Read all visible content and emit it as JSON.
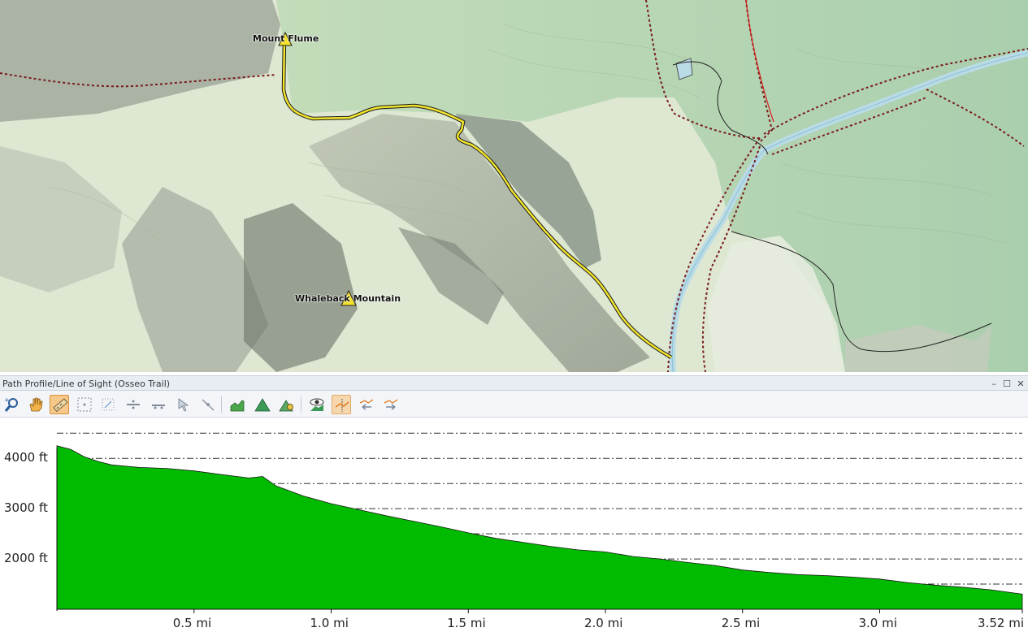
{
  "map": {
    "peaks": [
      {
        "name": "Mount Flume"
      },
      {
        "name": "Whaleback Mountain"
      }
    ],
    "colors": {
      "route": "#f2e52b",
      "trail": "#7a1b1b",
      "water": "#b9dbe6",
      "terrain_low": "#e8efdc",
      "terrain_shade": "#8a9086",
      "forest": "#b8d5b0"
    }
  },
  "panel": {
    "title": "Path Profile/Line of Sight (Osseo Trail)",
    "window_buttons": {
      "minimize": "–",
      "restore": "☐",
      "close": "✕"
    }
  },
  "toolbar": {
    "tools": [
      {
        "name": "zoom-icon"
      },
      {
        "name": "pan-hand-icon"
      },
      {
        "name": "ruler-measure-icon",
        "active": true
      },
      {
        "name": "grid-select-icon"
      },
      {
        "name": "grid-points-icon"
      },
      {
        "name": "horizontal-line-icon"
      },
      {
        "name": "line-segment-icon"
      },
      {
        "name": "pointer-icon"
      },
      {
        "name": "point-line-icon"
      },
      {
        "name": "profile-chart-icon"
      },
      {
        "name": "terrain-icon"
      },
      {
        "name": "terrain-settings-icon"
      },
      {
        "name": "line-of-sight-icon"
      },
      {
        "name": "show-profile-icon"
      },
      {
        "name": "profile-back-icon"
      },
      {
        "name": "profile-forward-icon"
      }
    ]
  },
  "chart_data": {
    "type": "area",
    "xlabel": "",
    "ylabel": "",
    "x_unit": "mi",
    "y_unit": "ft",
    "xlim": [
      0,
      3.52
    ],
    "ylim": [
      1000,
      4650
    ],
    "y_ticks": [
      {
        "value": 2000,
        "label": "2000 ft"
      },
      {
        "value": 3000,
        "label": "3000 ft"
      },
      {
        "value": 4000,
        "label": "4000 ft"
      }
    ],
    "x_ticks": [
      {
        "value": 0.5,
        "label": "0.5 mi"
      },
      {
        "value": 1.0,
        "label": "1.0 mi"
      },
      {
        "value": 1.5,
        "label": "1.5 mi"
      },
      {
        "value": 2.0,
        "label": "2.0 mi"
      },
      {
        "value": 2.5,
        "label": "2.5 mi"
      },
      {
        "value": 3.0,
        "label": "3.0 mi"
      },
      {
        "value": 3.52,
        "label": "3.52 mi"
      }
    ],
    "gridlines_ft": [
      1500,
      2000,
      2500,
      3000,
      3500,
      4000,
      4500
    ],
    "fill_color": "#00bb00",
    "series": [
      {
        "x": [
          0,
          0.05,
          0.1,
          0.15,
          0.2,
          0.3,
          0.4,
          0.5,
          0.6,
          0.7,
          0.75,
          0.8,
          0.9,
          1.0,
          1.1,
          1.2,
          1.3,
          1.4,
          1.5,
          1.6,
          1.7,
          1.8,
          1.9,
          2.0,
          2.1,
          2.2,
          2.3,
          2.4,
          2.5,
          2.6,
          2.7,
          2.8,
          2.9,
          3.0,
          3.1,
          3.2,
          3.3,
          3.4,
          3.52
        ],
        "y": [
          4250,
          4180,
          4030,
          3940,
          3870,
          3820,
          3800,
          3750,
          3680,
          3610,
          3640,
          3450,
          3250,
          3100,
          2980,
          2860,
          2750,
          2640,
          2520,
          2410,
          2330,
          2250,
          2180,
          2140,
          2050,
          2000,
          1930,
          1870,
          1780,
          1730,
          1690,
          1670,
          1640,
          1600,
          1530,
          1480,
          1440,
          1390,
          1300
        ]
      }
    ]
  }
}
